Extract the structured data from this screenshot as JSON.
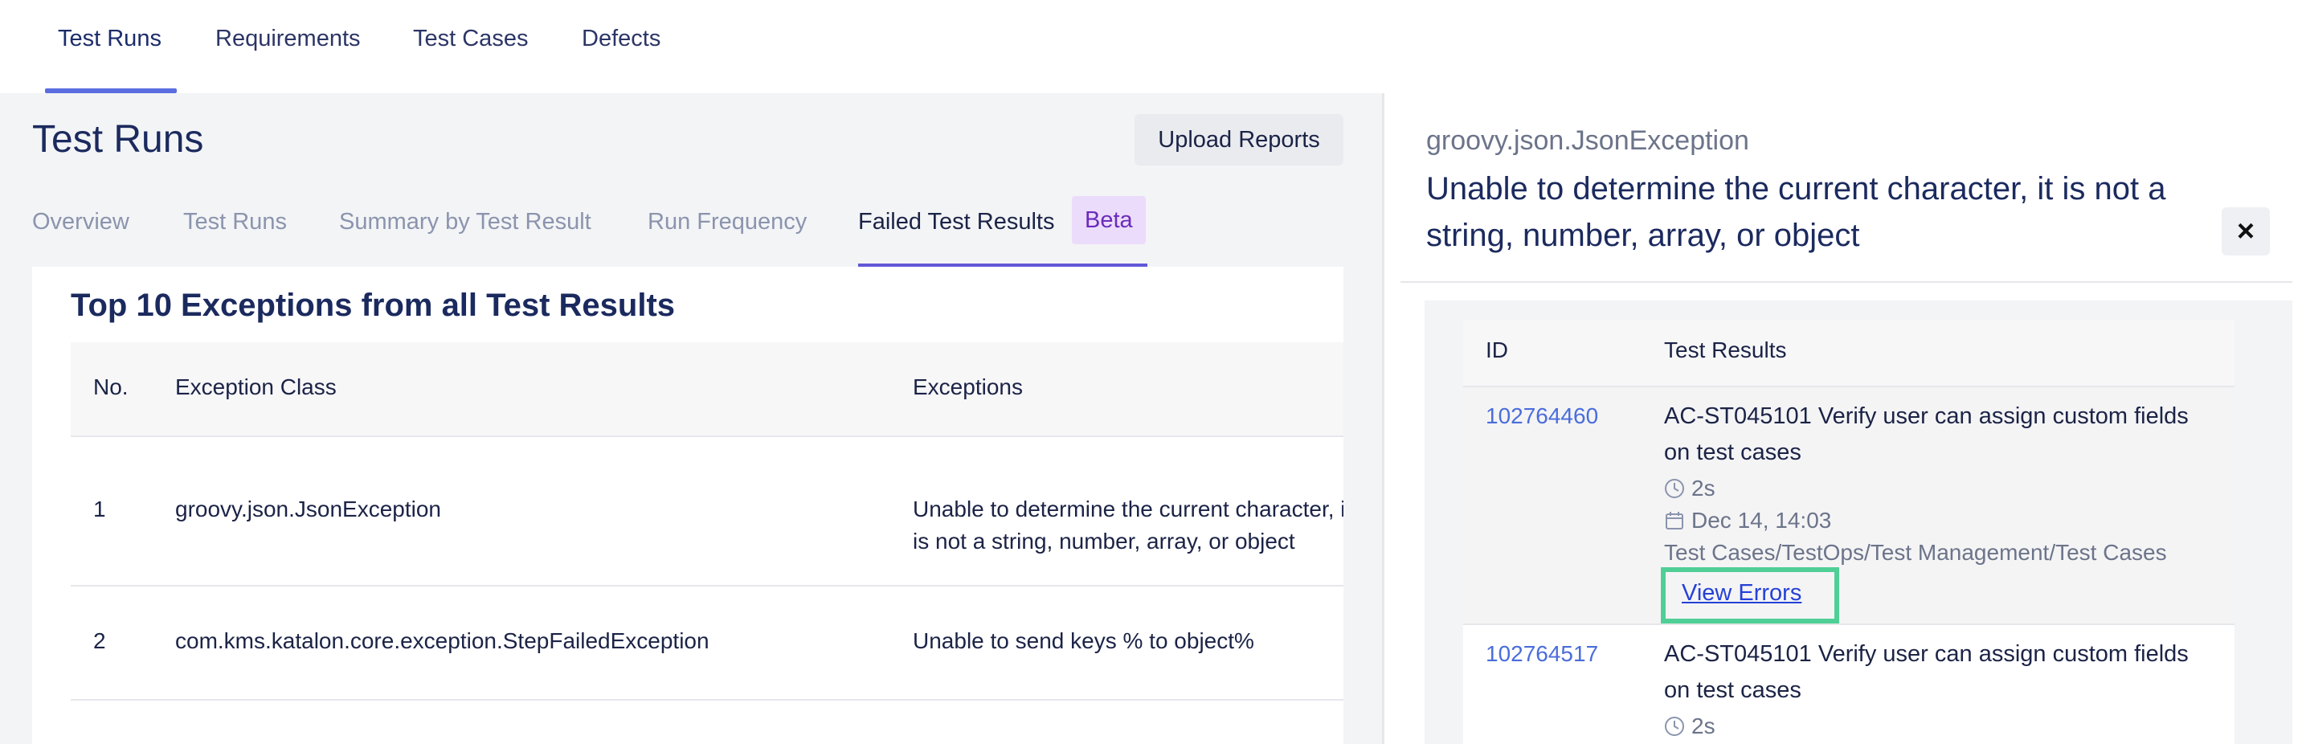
{
  "topnav": {
    "tabs": [
      {
        "label": "Test Runs",
        "active": true
      },
      {
        "label": "Requirements"
      },
      {
        "label": "Test Cases"
      },
      {
        "label": "Defects"
      }
    ]
  },
  "page": {
    "title": "Test Runs",
    "upload_button": "Upload Reports"
  },
  "subtabs": {
    "items": [
      "Overview",
      "Test Runs",
      "Summary by Test Result",
      "Run Frequency",
      "Failed Test Results"
    ],
    "badge": "Beta"
  },
  "exceptions_card": {
    "title": "Top 10 Exceptions from all Test Results",
    "columns": [
      "No.",
      "Exception Class",
      "Exceptions"
    ],
    "rows": [
      {
        "no": "1",
        "class": "groovy.json.JsonException",
        "exception": "Unable to determine the current character, it is not a string, number, array, or object"
      },
      {
        "no": "2",
        "class": "com.kms.katalon.core.exception.StepFailedException",
        "exception": "Unable to send keys % to object%"
      }
    ]
  },
  "panel": {
    "exception_class": "groovy.json.JsonException",
    "exception_message": "Unable to determine the current character, it is not a string, number, array, or object",
    "close_icon": "×",
    "columns": [
      "ID",
      "Test Results"
    ],
    "results": [
      {
        "id": "102764460",
        "name": "AC-ST045101 Verify user can assign custom fields on test cases",
        "duration": "2s",
        "date": "Dec 14, 14:03",
        "path": "Test Cases/TestOps/Test Management/Test Cases",
        "link": "View Errors"
      },
      {
        "id": "102764517",
        "name": "AC-ST045101 Verify user can assign custom fields on test cases",
        "duration": "2s"
      }
    ]
  },
  "colors": {
    "accent": "#5a6ee0",
    "highlight": "#4fcf96",
    "link": "#2541d6",
    "badge_bg": "#ecdcfb"
  }
}
